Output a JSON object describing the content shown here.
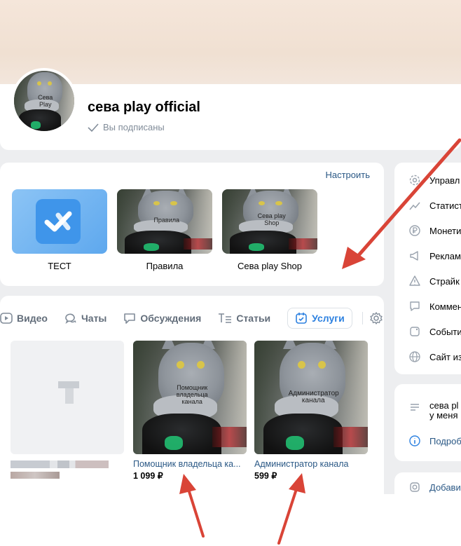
{
  "profile": {
    "title": "сева play official",
    "subscribed_label": "Вы подписаны",
    "avatar_caption": "Сева Play"
  },
  "links": {
    "configure_label": "Настроить",
    "tiles": [
      {
        "label": "ТЕСТ"
      },
      {
        "label": "Правила",
        "overlay": "Правила"
      },
      {
        "label": "Сева play Shop",
        "overlay": "Сева play Shop"
      }
    ]
  },
  "tabs": [
    {
      "label": "Видео",
      "icon": "play-icon"
    },
    {
      "label": "Чаты",
      "icon": "chat-icon"
    },
    {
      "label": "Обсуждения",
      "icon": "discussion-icon"
    },
    {
      "label": "Статьи",
      "icon": "article-icon"
    },
    {
      "label": "Услуги",
      "icon": "calendar-check-icon",
      "active": true
    }
  ],
  "goods": [
    {
      "name": "Помощник владельца ка...",
      "price": "1 099 ₽",
      "overlay": "Помощник владельца канала"
    },
    {
      "name": "Администратор канала",
      "price": "599 ₽",
      "overlay": "Администратор канала"
    }
  ],
  "sidebar": {
    "items": [
      {
        "label": "Управл",
        "icon": "gear-icon"
      },
      {
        "label": "Статист",
        "icon": "stats-icon"
      },
      {
        "label": "Монети",
        "icon": "ruble-icon"
      },
      {
        "label": "Реклам",
        "icon": "megaphone-icon"
      },
      {
        "label": "Страйк",
        "icon": "warning-icon"
      },
      {
        "label": "Коммен",
        "icon": "comment-icon"
      },
      {
        "label": "Событи",
        "icon": "event-icon"
      },
      {
        "label": "Сайт из",
        "icon": "globe-icon"
      }
    ],
    "about": {
      "line1": "сева pl",
      "line2": "у меня",
      "more": "Подроб"
    },
    "add": {
      "label": "Добавит"
    }
  },
  "colors": {
    "accent": "#2d81e0",
    "link": "#2a5885",
    "annotation_arrow": "#d94437",
    "background": "#edeef0"
  }
}
